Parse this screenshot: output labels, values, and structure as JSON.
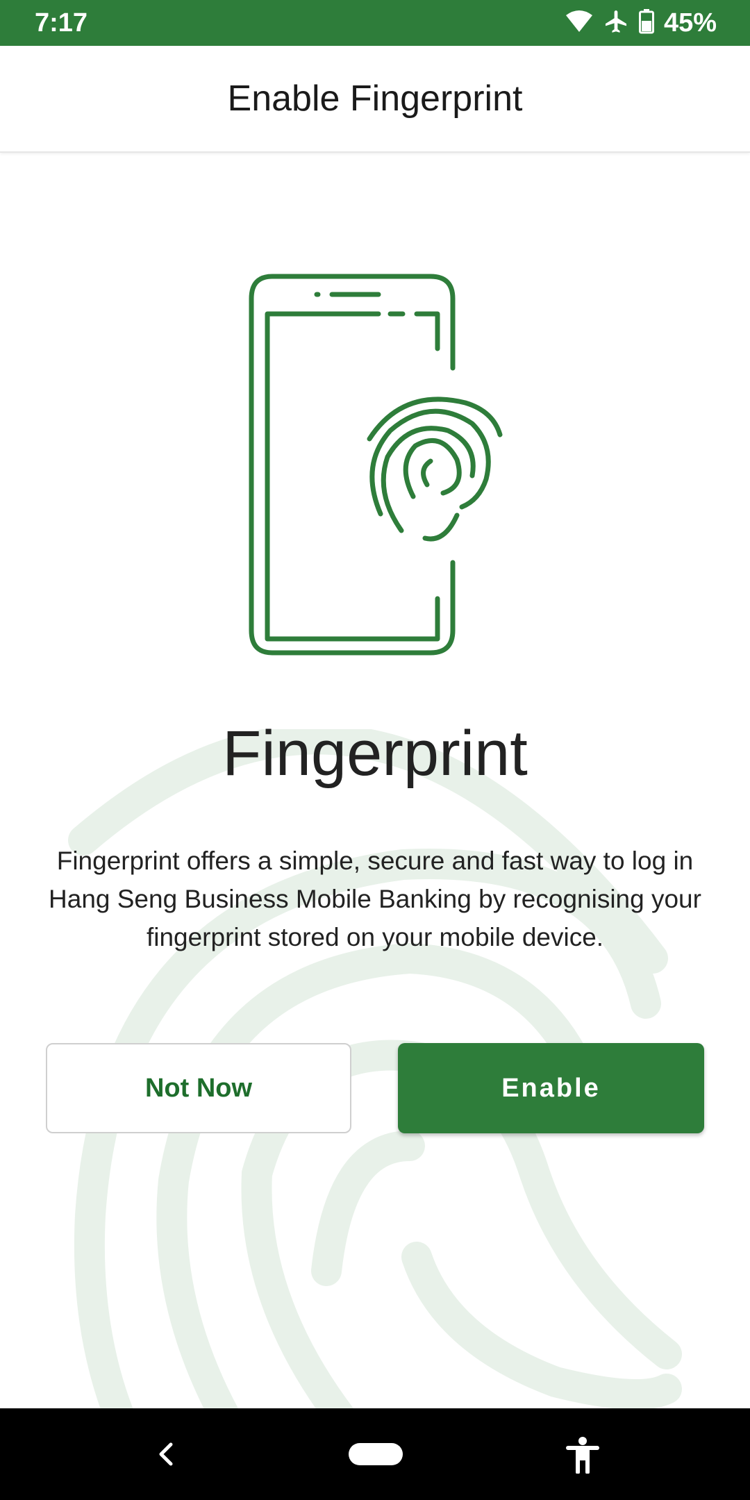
{
  "status_bar": {
    "time": "7:17",
    "battery_percent": "45%",
    "icons": [
      "wifi-icon",
      "airplane-mode-icon",
      "battery-icon"
    ],
    "background_color": "#2e7d3a"
  },
  "app_bar": {
    "title": "Enable Fingerprint"
  },
  "illustration": {
    "icon": "phone-fingerprint-icon",
    "color": "#2e7d3a"
  },
  "content": {
    "heading": "Fingerprint",
    "description": "Fingerprint offers a simple, secure and fast way to log in Hang Seng Business Mobile Banking by recognising your fingerprint stored on your mobile device."
  },
  "buttons": {
    "not_now_label": "Not Now",
    "enable_label": "Enable"
  },
  "colors": {
    "primary": "#2e7d3a",
    "watermark": "#e8f1e9"
  },
  "nav_bar": {
    "icons": [
      "back-icon",
      "home-pill",
      "accessibility-icon"
    ]
  }
}
